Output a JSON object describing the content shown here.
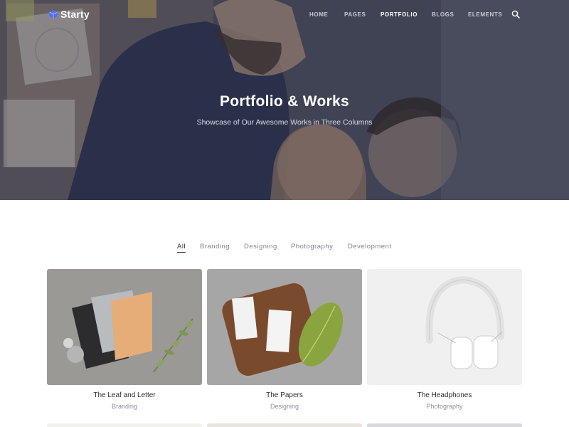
{
  "brand": {
    "name": "Starty",
    "logo_icon": "hexagon-cube-icon",
    "accent": "#4f6ef7"
  },
  "nav": {
    "items": [
      {
        "label": "HOME",
        "active": false
      },
      {
        "label": "PAGES",
        "active": false
      },
      {
        "label": "PORTFOLIO",
        "active": true
      },
      {
        "label": "BLOGS",
        "active": false
      },
      {
        "label": "ELEMENTS",
        "active": false
      }
    ],
    "search_icon": "search-icon"
  },
  "hero": {
    "title": "Portfolio & Works",
    "subtitle": "Showcase of Our Awesome Works in Three Columns"
  },
  "filters": [
    {
      "label": "All",
      "active": true
    },
    {
      "label": "Branding",
      "active": false
    },
    {
      "label": "Designing",
      "active": false
    },
    {
      "label": "Photography",
      "active": false
    },
    {
      "label": "Development",
      "active": false
    }
  ],
  "portfolio": [
    {
      "title": "The Leaf and Letter",
      "category": "Branding"
    },
    {
      "title": "The Papers",
      "category": "Designing"
    },
    {
      "title": "The Headphones",
      "category": "Photography"
    }
  ]
}
